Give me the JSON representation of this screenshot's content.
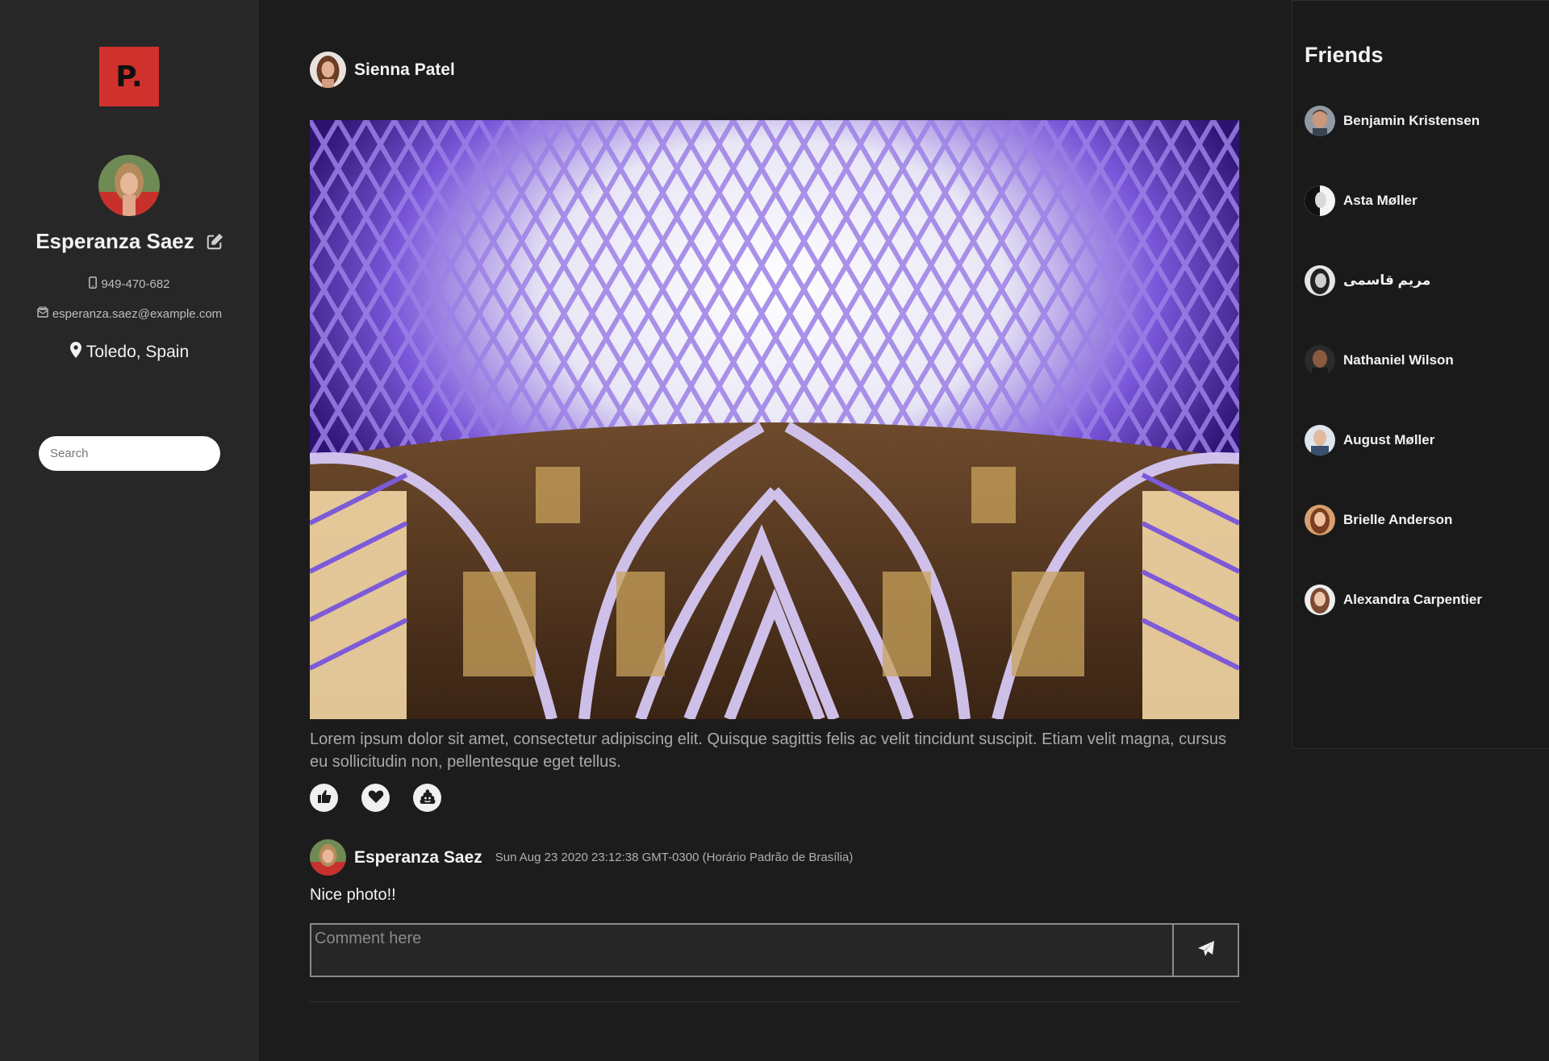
{
  "sidebar": {
    "logo_text": "P.",
    "profile": {
      "name": "Esperanza Saez",
      "phone": "949-470-682",
      "email": "esperanza.saez@example.com",
      "location": "Toledo, Spain"
    },
    "search": {
      "placeholder": "Search"
    }
  },
  "post": {
    "author": "Sienna Patel",
    "text": "Lorem ipsum dolor sit amet, consectetur adipiscing elit. Quisque sagittis felis ac velit tincidunt suscipit. Etiam velit magna, cursus eu sollicitudin non, pellentesque eget tellus.",
    "reactions": [
      "thumbs-up-icon",
      "heart-icon",
      "poop-icon"
    ],
    "comments": [
      {
        "author": "Esperanza Saez",
        "time": "Sun Aug 23 2020 23:12:38 GMT-0300 (Horário Padrão de Brasília)",
        "text": "Nice photo!!"
      }
    ],
    "comment_form": {
      "placeholder": "Comment here"
    }
  },
  "friends": {
    "title": "Friends",
    "items": [
      {
        "name": "Benjamin Kristensen"
      },
      {
        "name": "Asta Møller"
      },
      {
        "name": "مریم قاسمی"
      },
      {
        "name": "Nathaniel Wilson"
      },
      {
        "name": "August Møller"
      },
      {
        "name": "Brielle Anderson"
      },
      {
        "name": "Alexandra Carpentier"
      }
    ]
  },
  "colors": {
    "background": "#1c1c1c",
    "sidebar": "#272727",
    "logo": "#d0312d",
    "text": "#f2f2f2",
    "muted": "#a9a9a9"
  }
}
